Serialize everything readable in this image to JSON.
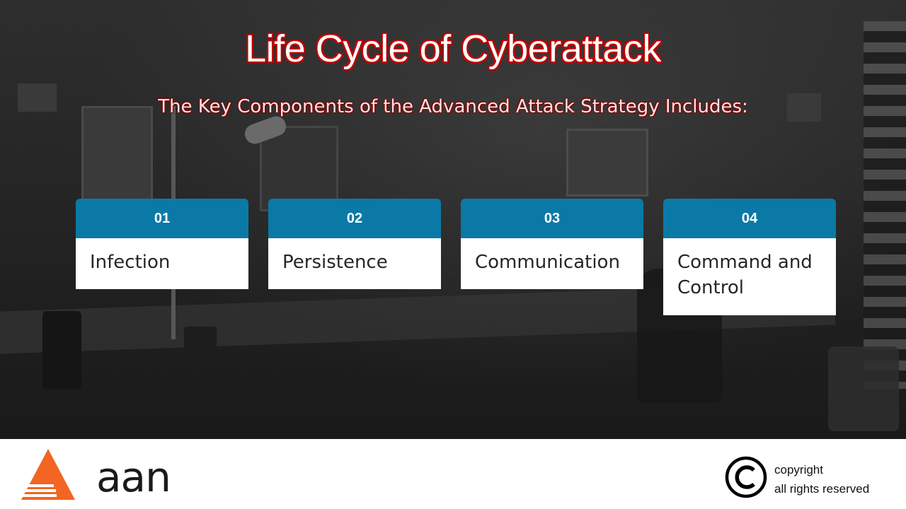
{
  "slide": {
    "title": "Life Cycle of Cyberattack",
    "subtitle": "The Key Components of the Advanced Attack Strategy Includes:"
  },
  "cards": [
    {
      "number": "01",
      "label": "Infection"
    },
    {
      "number": "02",
      "label": "Persistence"
    },
    {
      "number": "03",
      "label": "Communication"
    },
    {
      "number": "04",
      "label": "Command and Control"
    }
  ],
  "footer": {
    "logo_text": "aan",
    "copyright_line1": "copyright",
    "copyright_line2": "all rights reserved",
    "logo_color": "#f26522",
    "accent_color": "#0b79a6",
    "title_outline_color": "#c00000"
  }
}
